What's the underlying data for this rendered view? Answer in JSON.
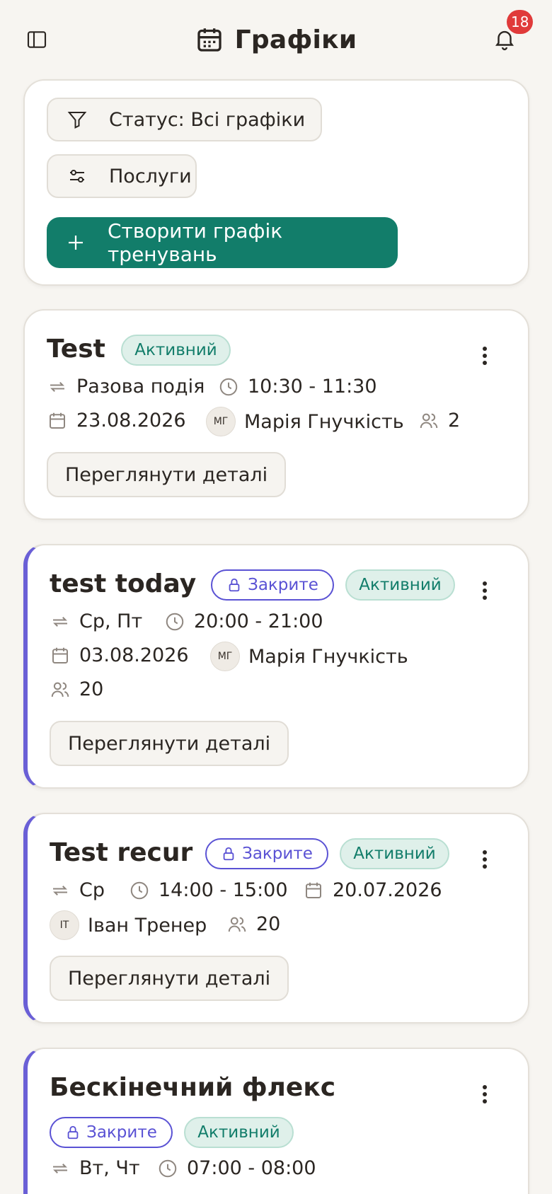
{
  "header": {
    "title": "Графіки",
    "notifications_count": "18",
    "icons": {
      "sidebar": "sidebar-toggle-icon",
      "title": "calendar-icon",
      "bell": "bell-icon"
    }
  },
  "filters": {
    "status_label": "Статус: Всі графіки",
    "services_label": "Послуги",
    "create_label": "Створити графік тренувань"
  },
  "common": {
    "active": "Активний",
    "closed": "Закрите",
    "details": "Переглянути деталі"
  },
  "schedules": [
    {
      "title": "Test",
      "recurrence": "Разова подія",
      "time": "10:30 - 11:30",
      "date": "23.08.2026",
      "trainer_initials": "МГ",
      "trainer": "Марія Гнучкість",
      "participants": "2",
      "closed": false
    },
    {
      "title": "test today",
      "recurrence": "Ср, Пт",
      "time": "20:00 - 21:00",
      "date": "03.08.2026",
      "trainer_initials": "МГ",
      "trainer": "Марія Гнучкість",
      "participants": "20",
      "closed": true
    },
    {
      "title": "Test recur",
      "recurrence": "Ср",
      "time": "14:00 - 15:00",
      "date": "20.07.2026",
      "trainer_initials": "ІТ",
      "trainer": "Іван Тренер",
      "participants": "20",
      "closed": true
    },
    {
      "title": "Бескінечний флекс",
      "recurrence": "Вт, Чт",
      "time": "07:00 - 08:00",
      "closed": true
    }
  ],
  "colors": {
    "brand": "#127d6a",
    "accent": "#6a5fd6",
    "badge": "#e03a3a"
  }
}
